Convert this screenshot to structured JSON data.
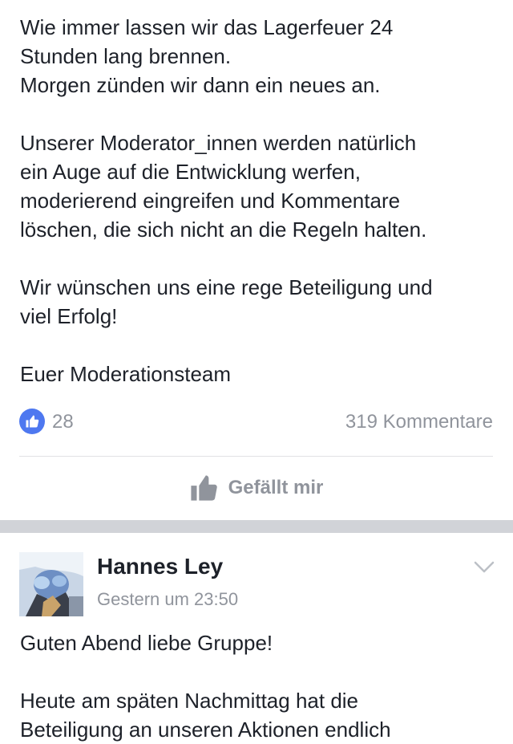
{
  "post1": {
    "text": "Wie immer lassen wir das Lagerfeuer 24\nStunden lang brennen.\nMorgen zünden wir dann ein neues an.\n\nUnserer Moderator_innen werden natürlich\nein Auge auf die Entwicklung werfen,\nmoderierend eingreifen und Kommentare\nlöschen, die sich nicht an die Regeln halten.\n\nWir wünschen uns eine rege Beteiligung und\nviel Erfolg!\n\nEuer Moderationsteam",
    "like_count": "28",
    "comments_count": "319 Kommentare",
    "like_button_label": "Gefällt mir"
  },
  "post2": {
    "author": "Hannes Ley",
    "timestamp": "Gestern um 23:50",
    "text": "Guten Abend liebe Gruppe!\n\nHeute am späten Nachmittag hat die\nBeteiligung an unseren Aktionen endlich"
  },
  "colors": {
    "like_blue": "#4e78f0",
    "meta_gray": "#90949c",
    "separator": "#d1d3d8"
  },
  "icons": {
    "like_reaction": "thumbs-up-icon",
    "like_action": "thumbs-up-icon",
    "options": "chevron-down-icon"
  }
}
